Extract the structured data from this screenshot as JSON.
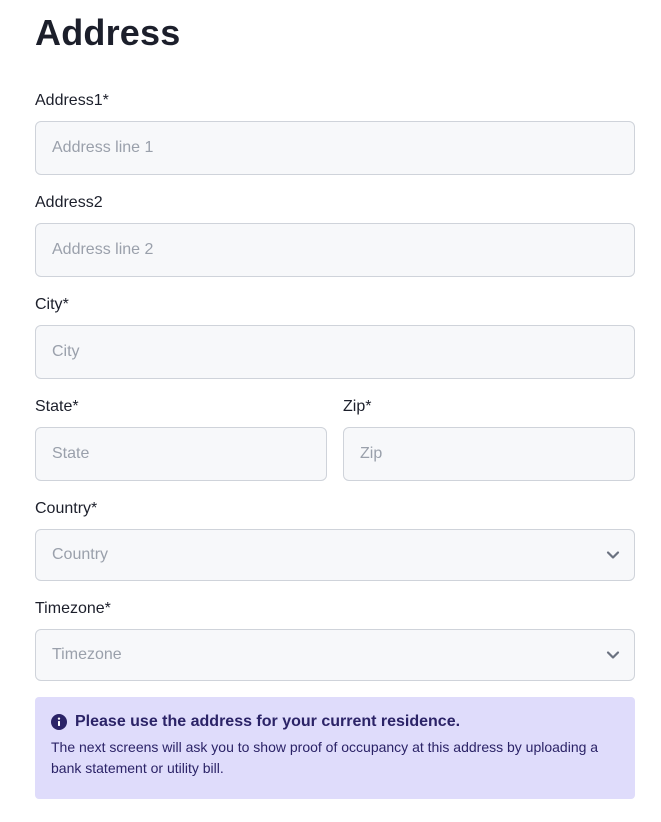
{
  "page": {
    "title": "Address"
  },
  "form": {
    "address1": {
      "label": "Address1",
      "required_mark": "*",
      "placeholder": "Address line 1"
    },
    "address2": {
      "label": "Address2",
      "placeholder": "Address line 2"
    },
    "city": {
      "label": "City",
      "required_mark": "*",
      "placeholder": "City"
    },
    "state": {
      "label": "State",
      "required_mark": "*",
      "placeholder": "State"
    },
    "zip": {
      "label": "Zip",
      "required_mark": "*",
      "placeholder": "Zip"
    },
    "country": {
      "label": "Country",
      "required_mark": "*",
      "placeholder": "Country",
      "icon": "chevron-down-icon"
    },
    "timezone": {
      "label": "Timezone",
      "required_mark": "*",
      "placeholder": "Timezone",
      "icon": "chevron-down-icon"
    }
  },
  "notice": {
    "icon": "info-icon",
    "title": "Please use the address for your current residence.",
    "body": "The next screens will ask you to show proof of occupancy at this address by uploading a bank statement or utility bill."
  },
  "colors": {
    "text": "#1c1f2b",
    "placeholder": "#9aa0ab",
    "input_bg": "#f7f8fa",
    "input_border": "#cfd3da",
    "notice_bg": "#dfdcfb",
    "notice_text": "#2b2367"
  }
}
